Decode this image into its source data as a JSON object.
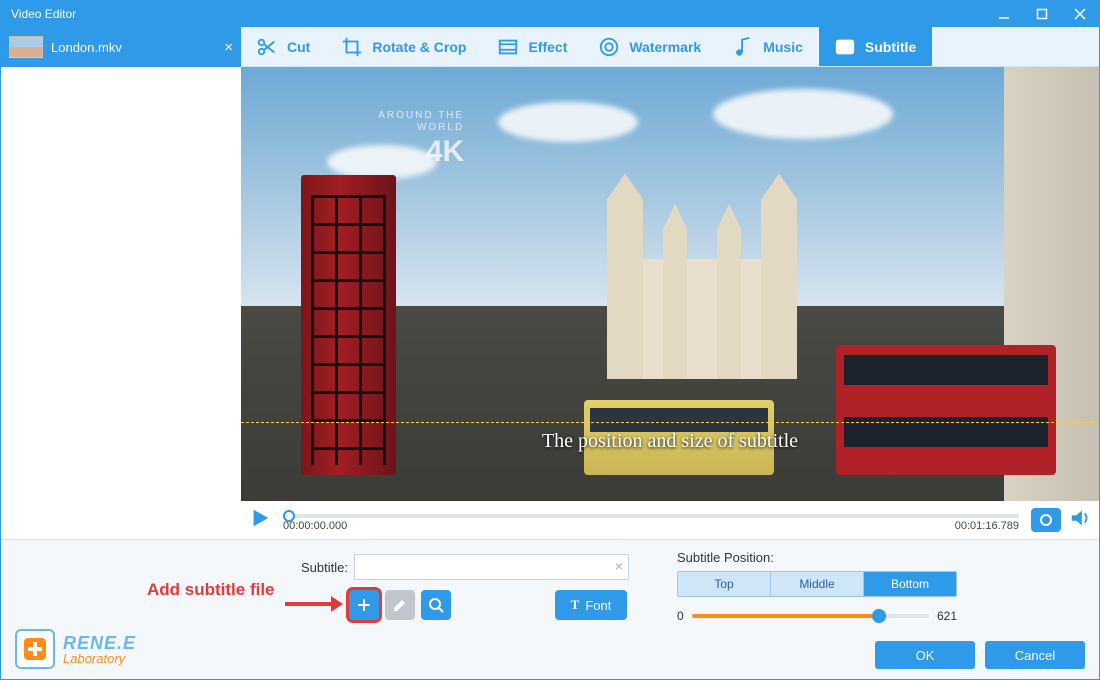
{
  "window": {
    "title": "Video Editor"
  },
  "file": {
    "name": "London.mkv"
  },
  "toolbar": {
    "cut": "Cut",
    "rotate": "Rotate & Crop",
    "effect": "Effect",
    "watermark": "Watermark",
    "music": "Music",
    "subtitle": "Subtitle"
  },
  "preview": {
    "watermark_line1": "AROUND THE",
    "watermark_line2": "WORLD",
    "watermark_big": "4K",
    "subtitle_overlay": "The position and size of subtitle"
  },
  "playback": {
    "current": "00:00:00.000",
    "total": "00:01:16.789"
  },
  "panel": {
    "subtitle_label": "Subtitle:",
    "subtitle_value": "",
    "font_label": "Font",
    "position_label": "Subtitle Position:",
    "pos_top": "Top",
    "pos_middle": "Middle",
    "pos_bottom": "Bottom",
    "slider_min": "0",
    "slider_max": "621",
    "annotation": "Add subtitle file"
  },
  "brand": {
    "line1": "RENE.E",
    "line2": "Laboratory"
  },
  "buttons": {
    "ok": "OK",
    "cancel": "Cancel"
  }
}
